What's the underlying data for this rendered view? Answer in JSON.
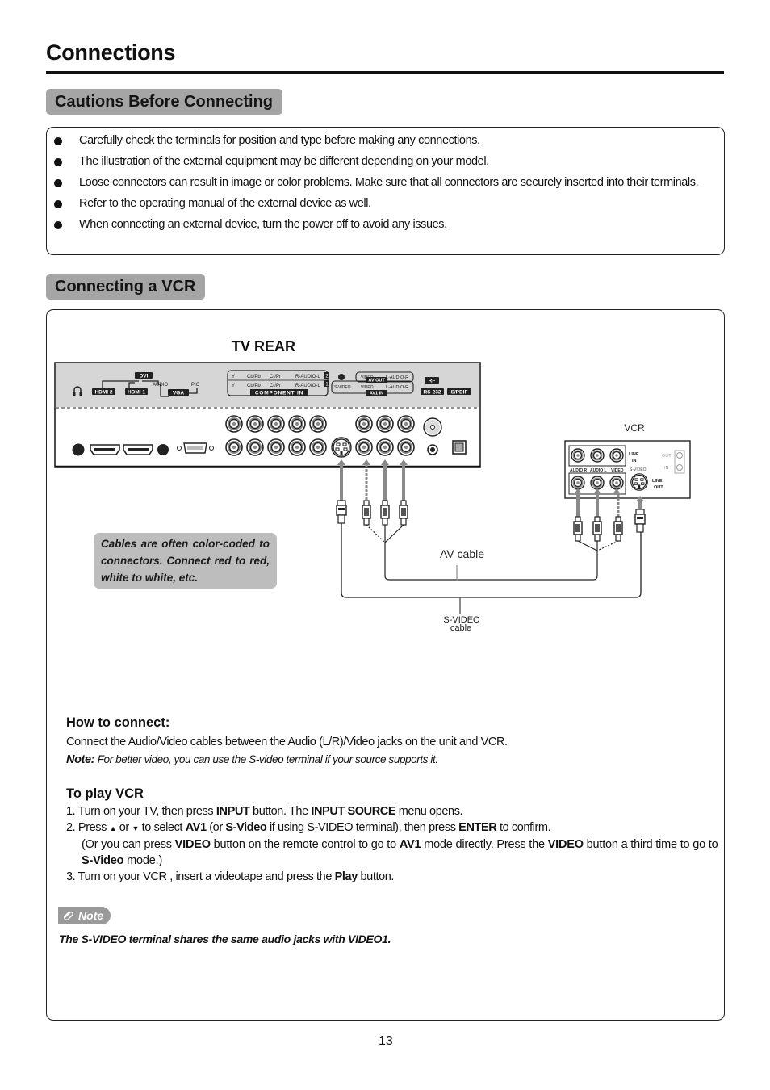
{
  "page": {
    "title": "Connections",
    "page_number": "13"
  },
  "cautions": {
    "heading": "Cautions Before Connecting",
    "items": [
      "Carefully check the terminals for position and type before making any connections.",
      "The illustration of the external equipment may be different depending on your model.",
      "Loose connectors can result in image or color problems. Make sure that all connectors are securely inserted into their terminals.",
      "Refer to the operating manual of the external device as well.",
      "When connecting an external device, turn the power off to avoid any issues."
    ]
  },
  "vcr_section": {
    "heading": "Connecting a VCR",
    "diagram": {
      "tv_rear_label": "TV REAR",
      "vcr_label": "VCR",
      "av_cable_label": "AV cable",
      "svideo_cable_label_line1": "S-VIDEO",
      "svideo_cable_label_line2": "cable",
      "tv_panel_labels": {
        "dvi": "DVI",
        "hdmi2": "HDMI 2",
        "hdmi1": "HDMI 1",
        "audio": "AUDIO",
        "pic": "PIC",
        "vga": "VGA",
        "y": "Y",
        "cb_pb": "Cb/Pb",
        "cr_pr": "Cr/Pr",
        "r_audio_l": "R-AUDIO-L",
        "component_in": "COMPONENT IN",
        "num2": "2",
        "num1": "1",
        "video": "VIDEO",
        "l_audio_r": "L-AUDIO-R",
        "av_out": "AV OUT",
        "s_video": "S-VIDEO",
        "av1_in": "AV1 IN",
        "rf": "RF",
        "rs232": "RS-232",
        "spdif": "S/PDIF"
      },
      "vcr_panel_labels": {
        "line_in_1": "LINE",
        "line_in_2": "IN",
        "audio_r": "AUDIO R",
        "audio_l": "AUDIO L",
        "video": "VIDEO",
        "s_video": "S-VIDEO",
        "line_out_1": "LINE",
        "line_out_2": "OUT",
        "out": "OUT",
        "in": "IN"
      }
    },
    "callout": "Cables are often color-coded to connectors. Connect red to red, white to white, etc.",
    "how_to": {
      "heading": "How to connect:",
      "text": "Connect the Audio/Video cables between the Audio (L/R)/Video jacks on the unit and VCR.",
      "note_label": "Note:",
      "note_text": "For better video, you can use the S-video terminal if your source supports it."
    },
    "to_play": {
      "heading": "To play VCR",
      "step1": {
        "a": "1. Turn on your TV,  then press ",
        "b": "INPUT",
        "c": " button. The ",
        "d": "INPUT SOURCE",
        "e": " menu opens."
      },
      "step2": {
        "a": "2. Press ",
        "up": "▲",
        "or": " or ",
        "down": "▼",
        "b": " to select ",
        "c": "AV1",
        "d": " (or ",
        "e": "S-Video",
        "f": " if using S-VIDEO terminal), then press ",
        "g": "ENTER",
        "h": " to confirm."
      },
      "step2b": {
        "a": "(Or you can press ",
        "b": "VIDEO",
        "c": " button on the remote control to go to ",
        "d": "AV1",
        "e": " mode directly. Press the ",
        "f": "VIDEO",
        "g": " button a third time to go to ",
        "h": "S-Video",
        "i": " mode.)"
      },
      "step3": {
        "a": "3. Turn on your VCR , insert a videotape and press the ",
        "b": "Play",
        "c": " button."
      }
    },
    "note": {
      "badge": "Note",
      "icon": "paperclip-icon",
      "text": "The S-VIDEO terminal shares the same audio jacks with VIDEO1."
    }
  }
}
